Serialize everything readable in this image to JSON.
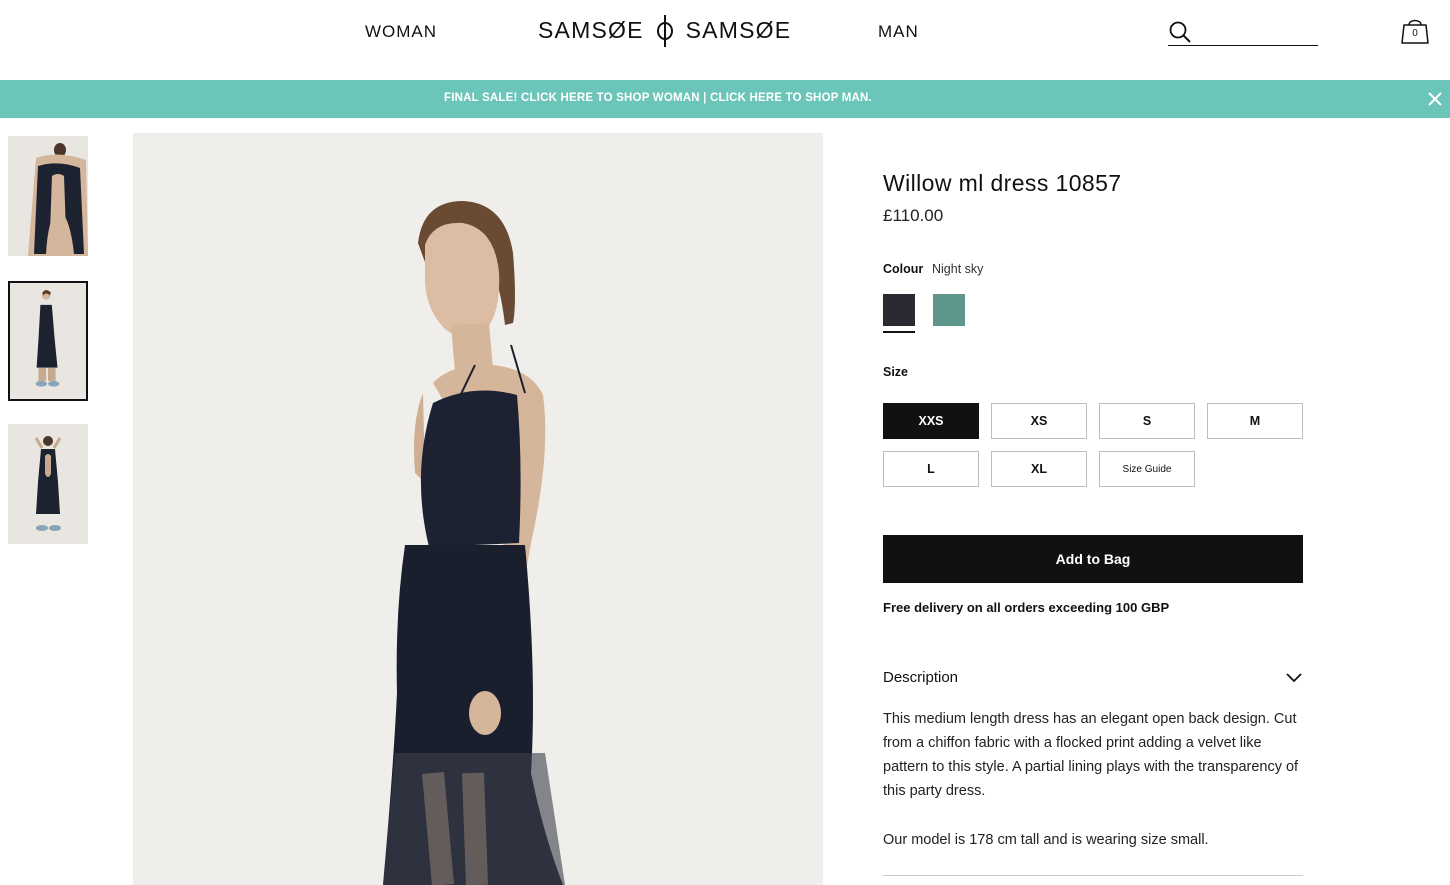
{
  "header": {
    "nav_woman": "WOMAN",
    "nav_man": "MAN",
    "logo_left": "SAMSØE",
    "logo_right": "SAMSØE",
    "search_placeholder": "",
    "bag_count": "0"
  },
  "banner": {
    "text": "FINAL SALE! CLICK HERE TO SHOP WOMAN | CLICK HERE TO SHOP MAN.",
    "color": "#6cc5b9"
  },
  "gallery": {
    "thumbnails": [
      "back view",
      "full front view",
      "full back view"
    ],
    "active_index": 1
  },
  "product": {
    "title": "Willow ml dress 10857",
    "price": "£110.00",
    "colour_label": "Colour",
    "colour_value": "Night sky",
    "swatches": [
      {
        "color": "#2b2a33",
        "selected": true
      },
      {
        "color": "#5e968b",
        "selected": false
      }
    ],
    "size_label": "Size",
    "sizes": [
      "XXS",
      "XS",
      "S",
      "M",
      "L",
      "XL"
    ],
    "selected_size": "XXS",
    "size_guide": "Size Guide",
    "add_to_bag": "Add to Bag",
    "delivery_note": "Free delivery on all orders exceeding 100 GBP",
    "description_title": "Description",
    "description": "This medium length dress has an elegant open back design. Cut from a chiffon fabric with a flocked print adding a velvet like pattern to this style. A partial lining plays with the transparency of this party dress.",
    "model_note": "Our model is 178 cm tall and is wearing size small."
  }
}
